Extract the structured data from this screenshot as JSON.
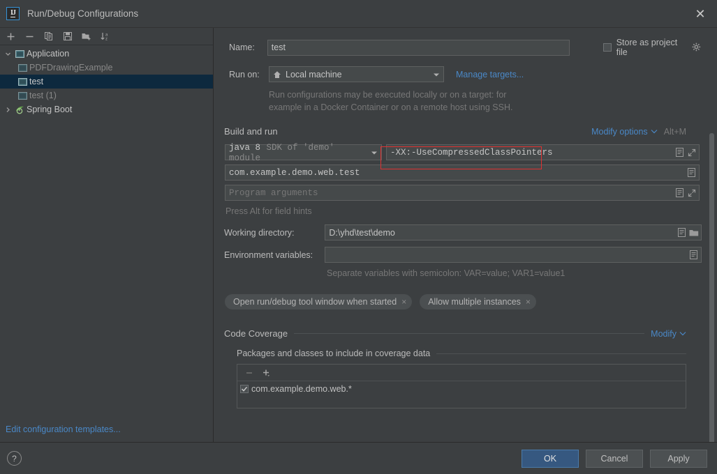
{
  "window": {
    "title": "Run/Debug Configurations",
    "logo_text": "IJ",
    "close_label": "✕"
  },
  "sidebar": {
    "toolbar": [
      {
        "name": "add-configuration-button",
        "icon": "plus-icon",
        "label": "+"
      },
      {
        "name": "remove-configuration-button",
        "icon": "minus-icon",
        "label": "−"
      },
      {
        "name": "copy-configuration-button",
        "icon": "copy-icon",
        "label": "Copy"
      },
      {
        "name": "save-configuration-button",
        "icon": "save-icon",
        "label": "Save"
      },
      {
        "name": "new-folder-button",
        "icon": "new-folder-icon",
        "label": "New Folder"
      },
      {
        "name": "sort-configurations-button",
        "icon": "sort-az-icon",
        "label": "Sort"
      }
    ],
    "tree": [
      {
        "label": "Application",
        "level": 0,
        "expanded": true,
        "arrow": "chevron-down",
        "icon": "application-icon",
        "dim": false,
        "selected": false
      },
      {
        "label": "PDFDrawingExample",
        "level": 1,
        "expanded": null,
        "arrow": "",
        "icon": "application-icon",
        "dim": true,
        "selected": false
      },
      {
        "label": "test",
        "level": 1,
        "expanded": null,
        "arrow": "",
        "icon": "application-icon",
        "dim": false,
        "selected": true
      },
      {
        "label": "test (1)",
        "level": 1,
        "expanded": null,
        "arrow": "",
        "icon": "application-icon",
        "dim": true,
        "selected": false
      },
      {
        "label": "Spring Boot",
        "level": 0,
        "expanded": false,
        "arrow": "chevron-right",
        "icon": "spring-boot-icon",
        "dim": false,
        "selected": false
      }
    ],
    "edit_templates_link": "Edit configuration templates..."
  },
  "form": {
    "name_label": "Name:",
    "name_value": "test",
    "store_as_project_file_label": "Store as project file",
    "store_as_project_file_checked": false,
    "run_on_label": "Run on:",
    "run_on_value": "Local machine",
    "manage_targets_link": "Manage targets...",
    "run_on_hint_line1": "Run configurations may be executed locally or on a target: for",
    "run_on_hint_line2": "example in a Docker Container or on a remote host using SSH.",
    "build_and_run": {
      "section_title": "Build and run",
      "modify_options_link": "Modify options",
      "modify_options_shortcut": "Alt+M",
      "sdk_primary": "java 8",
      "sdk_secondary": "SDK of 'demo' module",
      "vm_options_value": "-XX:-UseCompressedClassPointers",
      "main_class_value": "com.example.demo.web.test",
      "program_arguments_placeholder": "Program arguments",
      "field_hints": "Press Alt for field hints"
    },
    "working_directory_label": "Working directory:",
    "working_directory_value": "D:\\yhd\\test\\demo",
    "environment_variables_label": "Environment variables:",
    "environment_variables_value": "",
    "environment_variables_hint": "Separate variables with semicolon: VAR=value; VAR1=value1",
    "chips": [
      {
        "label": "Open run/debug tool window when started",
        "close": "×"
      },
      {
        "label": "Allow multiple instances",
        "close": "×"
      }
    ],
    "code_coverage": {
      "section_title": "Code Coverage",
      "modify_link": "Modify",
      "subsection_title": "Packages and classes to include in coverage data",
      "toolbar": [
        {
          "name": "remove-package-button",
          "icon": "minus-icon"
        },
        {
          "name": "add-package-button",
          "icon": "plus-dropdown-icon"
        }
      ],
      "items": [
        {
          "label": "com.example.demo.web.*",
          "checked": true
        }
      ]
    }
  },
  "footer": {
    "help_label": "?",
    "ok_label": "OK",
    "cancel_label": "Cancel",
    "apply_label": "Apply"
  },
  "colors": {
    "background": "#3c3f41",
    "field_background": "#45494a",
    "selection": "#0d293e",
    "link": "#4a88c7",
    "primary_button": "#365880",
    "annotation": "#e03131"
  }
}
